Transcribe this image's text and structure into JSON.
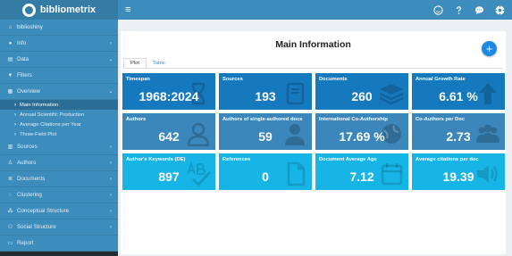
{
  "brand": {
    "name": "bibliometrix"
  },
  "navbar": {
    "menu_icon": "≡"
  },
  "sidebar": {
    "items": [
      {
        "label": "biblioshiny"
      },
      {
        "label": "Info"
      },
      {
        "label": "Data"
      },
      {
        "label": "Filters"
      },
      {
        "label": "Overview"
      },
      {
        "label": "Sources"
      },
      {
        "label": "Authors"
      },
      {
        "label": "Documents"
      },
      {
        "label": "Clustering"
      },
      {
        "label": "Conceptual Structure"
      },
      {
        "label": "Social Structure"
      },
      {
        "label": "Report"
      }
    ],
    "overview_sub": [
      {
        "label": "Main Information"
      },
      {
        "label": "Annual Scientific Production"
      },
      {
        "label": "Average Citations per Year"
      },
      {
        "label": "Three-Field Plot"
      }
    ]
  },
  "main": {
    "title": "Main Information",
    "tabs": [
      {
        "label": "Plot"
      },
      {
        "label": "Table"
      }
    ],
    "cards": [
      {
        "label": "Timespan",
        "value": "1968:2024",
        "icon": "hourglass-icon"
      },
      {
        "label": "Sources",
        "value": "193",
        "icon": "book-icon"
      },
      {
        "label": "Documents",
        "value": "260",
        "icon": "layers-icon"
      },
      {
        "label": "Annual Growth Rate",
        "value": "6.61 %",
        "icon": "arrow-up-icon"
      },
      {
        "label": "Authors",
        "value": "642",
        "icon": "user-icon"
      },
      {
        "label": "Authors of single-authored docs",
        "value": "59",
        "icon": "user-icon"
      },
      {
        "label": "International Co-Authorship",
        "value": "17.69 %",
        "icon": "globe-icon"
      },
      {
        "label": "Co-Authors per Doc",
        "value": "2.73",
        "icon": "users-icon"
      },
      {
        "label": "Author's Keywords (DE)",
        "value": "897",
        "icon": "spellcheck-icon"
      },
      {
        "label": "References",
        "value": "0",
        "icon": "file-icon"
      },
      {
        "label": "Document Average Age",
        "value": "7.12",
        "icon": "calendar-icon"
      },
      {
        "label": "Average citations per doc",
        "value": "19.39",
        "icon": "volume-icon"
      }
    ]
  },
  "colors": {
    "topbar": "#3c8dbc",
    "sidebar": "#222d32",
    "card_dark": "#1779bd",
    "card_mid": "#3b87bb",
    "card_light": "#17b4e6",
    "add_button": "#1e88e5"
  }
}
